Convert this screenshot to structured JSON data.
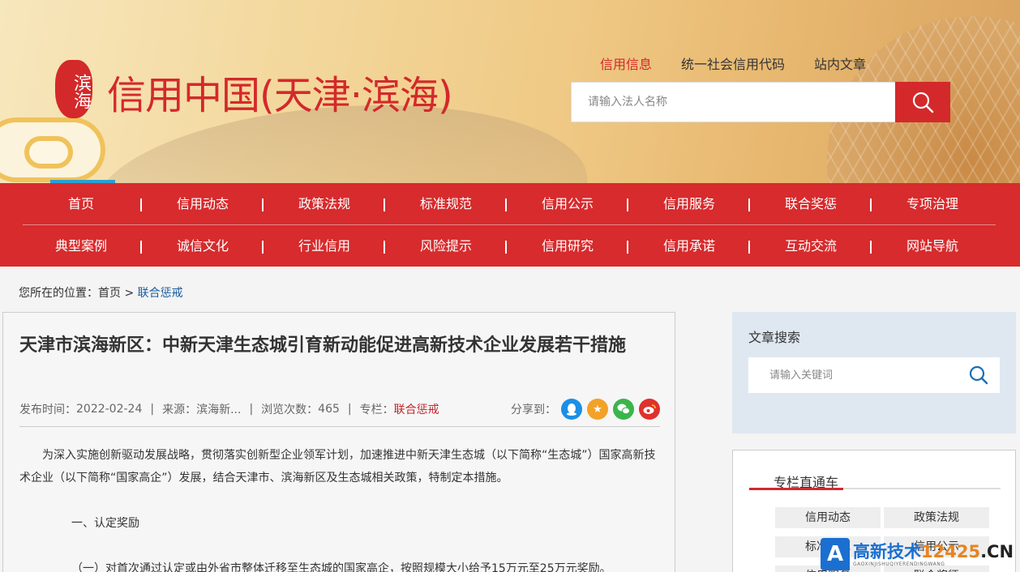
{
  "logo": {
    "seal_text": "滨海",
    "site_name": "信用中国(天津·滨海)"
  },
  "search": {
    "tabs": [
      "信用信息",
      "统一社会信用代码",
      "站内文章"
    ],
    "active_tab": "信用信息",
    "placeholder": "请输入法人名称"
  },
  "nav": {
    "row1": [
      "首页",
      "信用动态",
      "政策法规",
      "标准规范",
      "信用公示",
      "信用服务",
      "联合奖惩",
      "专项治理"
    ],
    "row2": [
      "典型案例",
      "诚信文化",
      "行业信用",
      "风险提示",
      "信用研究",
      "信用承诺",
      "互动交流",
      "网站导航"
    ]
  },
  "breadcrumb": {
    "label": "您所在的位置：",
    "home": "首页",
    "sep": ">",
    "current": "联合惩戒"
  },
  "article": {
    "title": "天津市滨海新区：中新天津生态城引育新动能促进高新技术企业发展若干措施",
    "publish_label": "发布时间：",
    "publish_date": "2022-02-24",
    "source_label": "来源：",
    "source": "滨海新...",
    "views_label": "浏览次数：",
    "views": "465",
    "column_label": "专栏：",
    "column": "联合惩戒",
    "share_label": "分享到：",
    "paragraphs": [
      "为深入实施创新驱动发展战略，贯彻落实创新型企业领军计划，加速推进中新天津生态城（以下简称“生态城”）国家高新技术企业（以下简称“国家高企”）发展，结合天津市、滨海新区及生态城相关政策，特制定本措施。",
      "一、认定奖励",
      "（一）对首次通过认定或由外省市整体迁移至生态城的国家高企，按照规模大小给予15万元至25万元奖励。"
    ]
  },
  "sidebar": {
    "search_title": "文章搜索",
    "search_placeholder": "请输入关键词",
    "column_title": "专栏直通车",
    "column_items": [
      "信用动态",
      "政策法规",
      "标准规范",
      "信用公示",
      "信用服务",
      "联合奖惩"
    ]
  },
  "watermark": {
    "main": "高新技术",
    "num": "12425",
    "cn": ".CN",
    "sub": "GAOXINJISHUQIYERENDINGWANG"
  },
  "colors": {
    "brand_red": "#d3292b",
    "nav_red": "#d72b2d",
    "active_blue": "#2a9fd6",
    "link_blue": "#1a5c99"
  }
}
